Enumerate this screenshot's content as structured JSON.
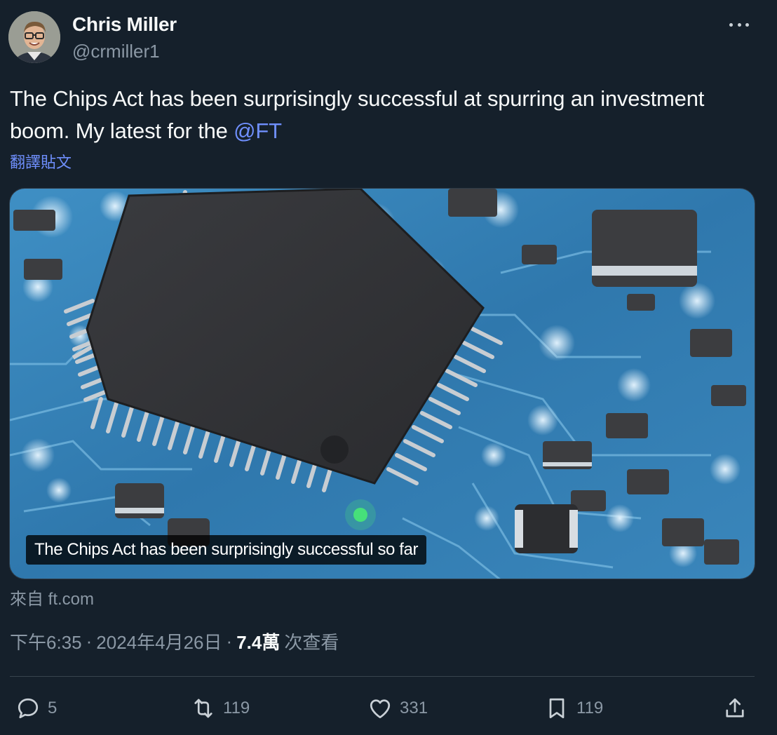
{
  "author": {
    "name": "Chris Miller",
    "handle": "@crmiller1",
    "avatar_icon": "profile-photo"
  },
  "post": {
    "text_before_mention": "The Chips Act has been surprisingly successful at spurring an investment boom. My latest for the ",
    "mention": "@FT",
    "translate_label": "翻譯貼文"
  },
  "card": {
    "image_subject": "circuit-board-chip",
    "caption": "The Chips Act has been surprisingly successful so far",
    "source": "來自 ft.com"
  },
  "meta": {
    "time": "下午6:35",
    "separator": "·",
    "date": "2024年4月26日",
    "views_count": "7.4萬",
    "views_label": "次查看"
  },
  "actions": {
    "reply_count": "5",
    "repost_count": "119",
    "like_count": "331",
    "bookmark_count": "119"
  },
  "colors": {
    "background": "#15202b",
    "accent": "#6f8ffd",
    "secondary_text": "#8b98a5"
  }
}
